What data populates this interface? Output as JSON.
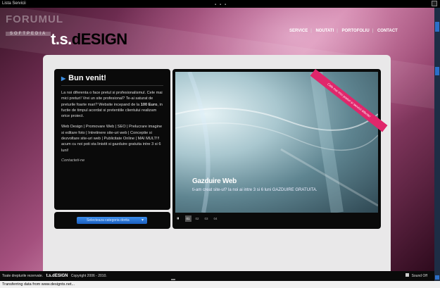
{
  "window": {
    "title": "Lista Servicii"
  },
  "watermark": {
    "line1": "FORUMUL",
    "line2": "SOFTPEDIA"
  },
  "logo": {
    "part1": "t.s.",
    "part2": "dESIGN"
  },
  "nav": {
    "items": [
      "SERVICE",
      "NOUTATI",
      "PORTOFOLIU",
      "CONTACT"
    ]
  },
  "welcome": {
    "title": "Bun venit!",
    "p1_a": "La noi diferenta o face pretul si profesionalismul. Cele mai mici preturi! Vrei un site profesional? Te-ai saturat de preturile foarte mari? Website incepand de la ",
    "p1_price": "100 Euro",
    "p1_b": ", in fuctie de timpul acordat si pretentiile clientului realizam orice proiect.",
    "p2": "Web Design | Promovare Web | SEO | Prelucrare imagine si editare foto | Intretinere site-uri web | Conceptie si dezvoltare site-uri web | Publicitate Online | MAI MULT!!! acum cu noi poti sta linistit si gazduire gratuita intre 3 si 6 luni!",
    "contact": "Contacteti-ne"
  },
  "category_select": {
    "label": "Selecteaza categoria dorita"
  },
  "slider": {
    "title": "Gazduire Web",
    "text": "ti-am creat site-ul? la noi ai intre 3 si 6 luni GAZDUIRE GRATUITA.",
    "pause_icon": "⏸",
    "slides": [
      "01",
      "02",
      "03",
      "04"
    ],
    "active_slide": "01"
  },
  "ribbon": {
    "text": "Cele mai mici preturi si servicii diferite!"
  },
  "footer": {
    "rights": "Toate drepturile rezervate.",
    "brand": "t.s.dESIGN",
    "copyright": "Copyright 2006 - 2010.",
    "sound": "Sound Off"
  },
  "status": {
    "text": "Transferring data from www.designts.net..."
  },
  "colors": {
    "accent": "#e0266b",
    "select_blue": "#2b6fc8",
    "panel": "#e9e8e9"
  }
}
